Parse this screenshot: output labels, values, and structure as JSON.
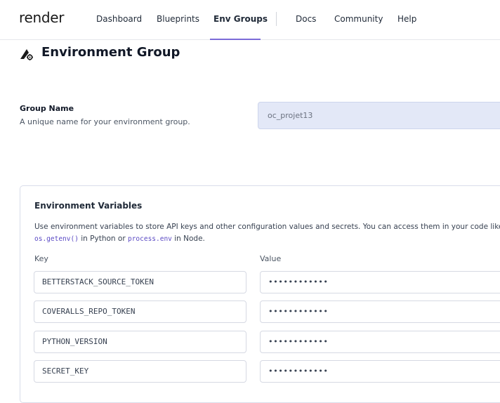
{
  "brand": {
    "logo_text": "render"
  },
  "nav": {
    "items": [
      {
        "label": "Dashboard"
      },
      {
        "label": "Blueprints"
      },
      {
        "label": "Env Groups",
        "active": true
      },
      {
        "label": "Docs"
      },
      {
        "label": "Community"
      },
      {
        "label": "Help"
      }
    ],
    "accent_color": "#7c6bd8"
  },
  "page": {
    "title": "Environment Group",
    "title_icon": "env-group-icon"
  },
  "group_name": {
    "label": "Group Name",
    "description": "A unique name for your environment group.",
    "value": "oc_projet13"
  },
  "env_vars": {
    "title": "Environment Variables",
    "desc_line1": "Use environment variables to store API keys and other configuration values and secrets. You can access them in your code like",
    "desc_code1": "os.getenv()",
    "desc_mid1": " in Python or ",
    "desc_code2": "process.env",
    "desc_end": " in Node.",
    "key_header": "Key",
    "value_header": "Value",
    "rows": [
      {
        "key": "BETTERSTACK_SOURCE_TOKEN",
        "value": "••••••••••••"
      },
      {
        "key": "COVERALLS_REPO_TOKEN",
        "value": "••••••••••••"
      },
      {
        "key": "PYTHON_VERSION",
        "value": "••••••••••••"
      },
      {
        "key": "SECRET_KEY",
        "value": "••••••••••••"
      }
    ]
  }
}
